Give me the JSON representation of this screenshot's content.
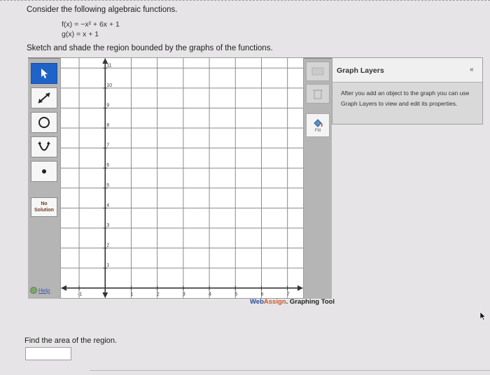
{
  "question": {
    "prompt": "Consider the following algebraic functions.",
    "f_x": "f(x) = −x² + 6x + 1",
    "g_x": "g(x) = x + 1",
    "instruction": "Sketch and shade the region bounded by the graphs of the functions."
  },
  "tools": {
    "no_solution_line1": "No",
    "no_solution_line2": "Solution",
    "help_label": "Help"
  },
  "graph": {
    "x_tick_labels": [
      "-1",
      "1",
      "2",
      "3",
      "4",
      "5",
      "6",
      "7"
    ],
    "y_tick_labels": [
      "11",
      "10",
      "9",
      "8",
      "7",
      "6",
      "5",
      "4",
      "3",
      "2",
      "1"
    ],
    "x_range": [
      -1.7,
      7.6
    ],
    "y_range": [
      -0.5,
      11.5
    ]
  },
  "side_tools": {
    "fill_label": "Fill"
  },
  "brand": {
    "web": "Web",
    "assign": "Assign",
    "tool": ". Graphing Tool"
  },
  "layers": {
    "title": "Graph Layers",
    "collapse": "«",
    "description": "After you add an object to the graph you can use Graph Layers to view and edit its properties."
  },
  "answer": {
    "label": "Find the area of the region.",
    "value": ""
  }
}
